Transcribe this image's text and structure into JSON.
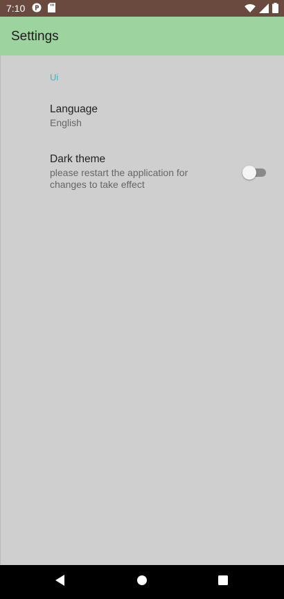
{
  "status_bar": {
    "time": "7:10",
    "left_icons": [
      "notification-app-icon",
      "sd-card-icon"
    ],
    "right_icons": [
      "wifi-icon",
      "signal-icon",
      "battery-icon"
    ],
    "color": "#6a4a3e"
  },
  "app_bar": {
    "title": "Settings",
    "color": "#9dd39e"
  },
  "preferences": {
    "category_title": "Ui",
    "category_color": "#22c3c0",
    "language": {
      "title": "Language",
      "summary": "English"
    },
    "dark_theme": {
      "title": "Dark theme",
      "summary": "please restart the application for changes to take effect",
      "enabled": false
    }
  },
  "nav_bar": {
    "buttons": [
      "back-icon",
      "home-icon",
      "recents-icon"
    ]
  }
}
